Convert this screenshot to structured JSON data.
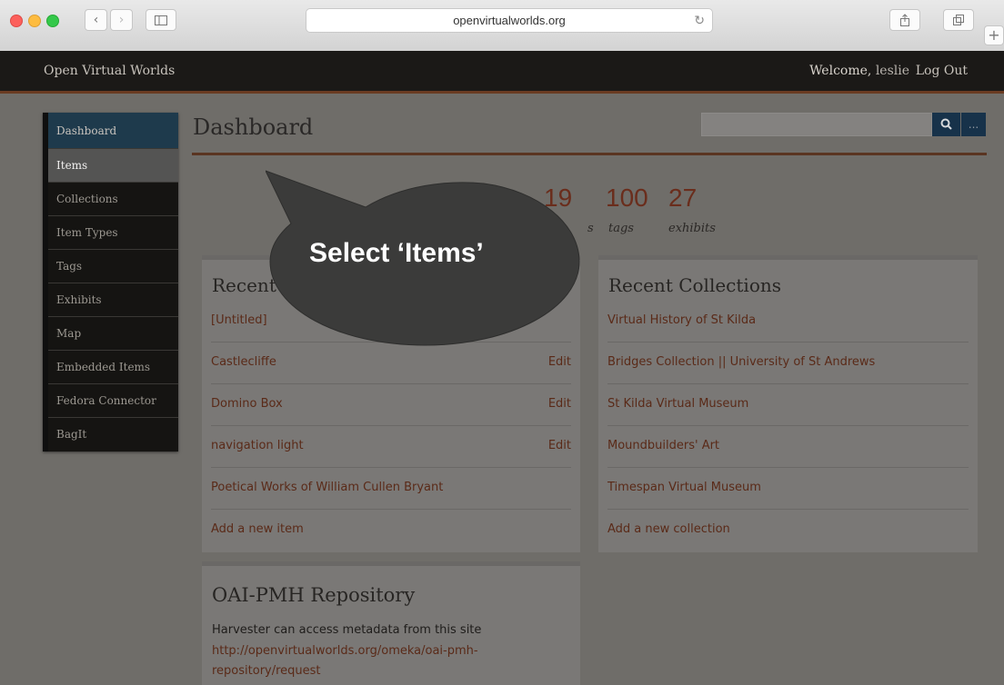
{
  "browser": {
    "url": "openvirtualworlds.org",
    "back_icon": "chevron-left",
    "forward_icon": "chevron-right"
  },
  "site": {
    "brand": "Open Virtual Worlds",
    "welcome": "Welcome,",
    "username": "leslie",
    "logout": "Log Out"
  },
  "sidebar": {
    "items": [
      {
        "label": "Dashboard"
      },
      {
        "label": "Items"
      },
      {
        "label": "Collections"
      },
      {
        "label": "Item Types"
      },
      {
        "label": "Tags"
      },
      {
        "label": "Exhibits"
      },
      {
        "label": "Map"
      },
      {
        "label": "Embedded Items"
      },
      {
        "label": "Fedora Connector"
      },
      {
        "label": "BagIt"
      }
    ]
  },
  "page": {
    "title": "Dashboard",
    "search_placeholder": "",
    "more_label": "..."
  },
  "stats": [
    {
      "num": "19",
      "label": "s"
    },
    {
      "num": "100",
      "label": "tags"
    },
    {
      "num": "27",
      "label": "exhibits"
    }
  ],
  "recent_items": {
    "title": "Recent",
    "rows": [
      {
        "name": "[Untitled]",
        "edit": ""
      },
      {
        "name": "Castlecliffe",
        "edit": "Edit"
      },
      {
        "name": "Domino Box",
        "edit": "Edit"
      },
      {
        "name": "navigation light",
        "edit": "Edit"
      },
      {
        "name": "Poetical Works of William Cullen Bryant",
        "edit": ""
      }
    ],
    "add": "Add a new item"
  },
  "recent_collections": {
    "title": "Recent Collections",
    "rows": [
      {
        "name": "Virtual History of St Kilda"
      },
      {
        "name": "Bridges Collection || University of St Andrews"
      },
      {
        "name": "St Kilda Virtual Museum"
      },
      {
        "name": "Moundbuilders' Art"
      },
      {
        "name": "Timespan Virtual Museum"
      }
    ],
    "add": "Add a new collection"
  },
  "oai": {
    "title": "OAI-PMH Repository",
    "text": "Harvester can access metadata from this site",
    "link": "http://openvirtualworlds.org/omeka/oai-pmh-repository/request"
  },
  "callout": {
    "text": "Select ‘Items’"
  },
  "colors": {
    "accent": "#6a2d1c",
    "sidebar_active": "#1e3a4c",
    "search_button": "#17324a"
  }
}
